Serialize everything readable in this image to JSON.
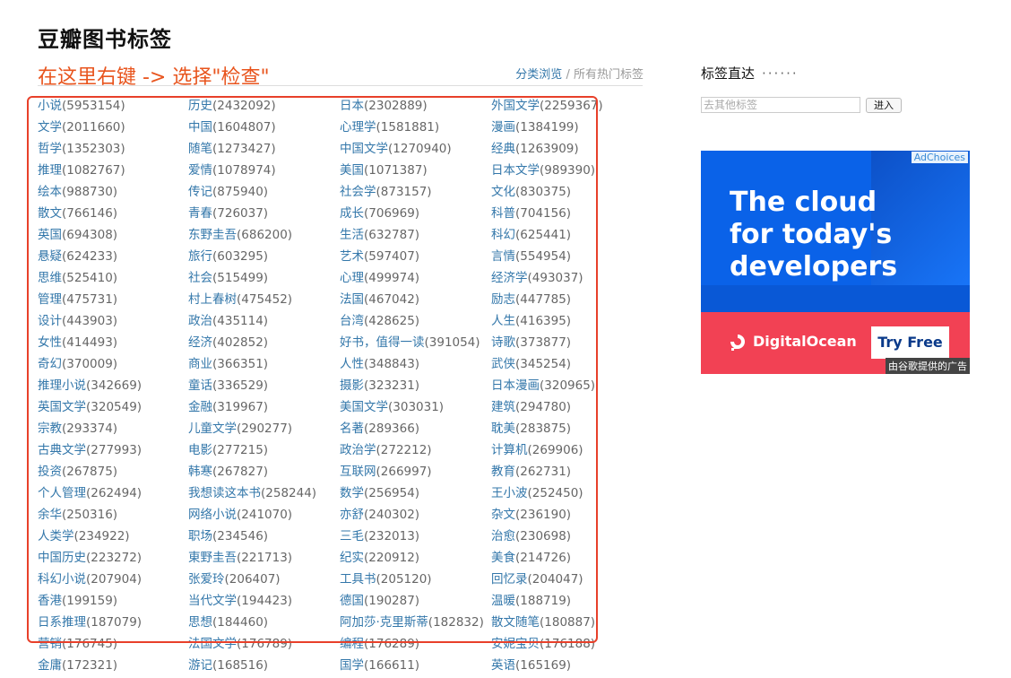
{
  "page": {
    "title": "豆瓣图书标签",
    "annotation": "在这里右键 -> 选择\"检查\"",
    "browse_link": "分类浏览",
    "separator": "/",
    "hot_tags": "所有热门标签"
  },
  "tags": [
    [
      {
        "name": "小说",
        "count": "(5953154)"
      },
      {
        "name": "历史",
        "count": "(2432092)"
      },
      {
        "name": "日本",
        "count": "(2302889)"
      },
      {
        "name": "外国文学",
        "count": "(2259367)"
      }
    ],
    [
      {
        "name": "文学",
        "count": "(2011660)"
      },
      {
        "name": "中国",
        "count": "(1604807)"
      },
      {
        "name": "心理学",
        "count": "(1581881)"
      },
      {
        "name": "漫画",
        "count": "(1384199)"
      }
    ],
    [
      {
        "name": "哲学",
        "count": "(1352303)"
      },
      {
        "name": "随笔",
        "count": "(1273427)"
      },
      {
        "name": "中国文学",
        "count": "(1270940)"
      },
      {
        "name": "经典",
        "count": "(1263909)"
      }
    ],
    [
      {
        "name": "推理",
        "count": "(1082767)"
      },
      {
        "name": "爱情",
        "count": "(1078974)"
      },
      {
        "name": "美国",
        "count": "(1071387)"
      },
      {
        "name": "日本文学",
        "count": "(989390)"
      }
    ],
    [
      {
        "name": "绘本",
        "count": "(988730)"
      },
      {
        "name": "传记",
        "count": "(875940)"
      },
      {
        "name": "社会学",
        "count": "(873157)"
      },
      {
        "name": "文化",
        "count": "(830375)"
      }
    ],
    [
      {
        "name": "散文",
        "count": "(766146)"
      },
      {
        "name": "青春",
        "count": "(726037)"
      },
      {
        "name": "成长",
        "count": "(706969)"
      },
      {
        "name": "科普",
        "count": "(704156)"
      }
    ],
    [
      {
        "name": "英国",
        "count": "(694308)"
      },
      {
        "name": "东野圭吾",
        "count": "(686200)"
      },
      {
        "name": "生活",
        "count": "(632787)"
      },
      {
        "name": "科幻",
        "count": "(625441)"
      }
    ],
    [
      {
        "name": "悬疑",
        "count": "(624233)"
      },
      {
        "name": "旅行",
        "count": "(603295)"
      },
      {
        "name": "艺术",
        "count": "(597407)"
      },
      {
        "name": "言情",
        "count": "(554954)"
      }
    ],
    [
      {
        "name": "思维",
        "count": "(525410)"
      },
      {
        "name": "社会",
        "count": "(515499)"
      },
      {
        "name": "心理",
        "count": "(499974)"
      },
      {
        "name": "经济学",
        "count": "(493037)"
      }
    ],
    [
      {
        "name": "管理",
        "count": "(475731)"
      },
      {
        "name": "村上春树",
        "count": "(475452)"
      },
      {
        "name": "法国",
        "count": "(467042)"
      },
      {
        "name": "励志",
        "count": "(447785)"
      }
    ],
    [
      {
        "name": "设计",
        "count": "(443903)"
      },
      {
        "name": "政治",
        "count": "(435114)"
      },
      {
        "name": "台湾",
        "count": "(428625)"
      },
      {
        "name": "人生",
        "count": "(416395)"
      }
    ],
    [
      {
        "name": "女性",
        "count": "(414493)"
      },
      {
        "name": "经济",
        "count": "(402852)"
      },
      {
        "name": "好书，值得一读",
        "count": "(391054)"
      },
      {
        "name": "诗歌",
        "count": "(373877)"
      }
    ],
    [
      {
        "name": "奇幻",
        "count": "(370009)"
      },
      {
        "name": "商业",
        "count": "(366351)"
      },
      {
        "name": "人性",
        "count": "(348843)"
      },
      {
        "name": "武侠",
        "count": "(345254)"
      }
    ],
    [
      {
        "name": "推理小说",
        "count": "(342669)"
      },
      {
        "name": "童话",
        "count": "(336529)"
      },
      {
        "name": "摄影",
        "count": "(323231)"
      },
      {
        "name": "日本漫画",
        "count": "(320965)"
      }
    ],
    [
      {
        "name": "英国文学",
        "count": "(320549)"
      },
      {
        "name": "金融",
        "count": "(319967)"
      },
      {
        "name": "美国文学",
        "count": "(303031)"
      },
      {
        "name": "建筑",
        "count": "(294780)"
      }
    ],
    [
      {
        "name": "宗教",
        "count": "(293374)"
      },
      {
        "name": "儿童文学",
        "count": "(290277)"
      },
      {
        "name": "名著",
        "count": "(289366)"
      },
      {
        "name": "耽美",
        "count": "(283875)"
      }
    ],
    [
      {
        "name": "古典文学",
        "count": "(277993)"
      },
      {
        "name": "电影",
        "count": "(277215)"
      },
      {
        "name": "政治学",
        "count": "(272212)"
      },
      {
        "name": "计算机",
        "count": "(269906)"
      }
    ],
    [
      {
        "name": "投资",
        "count": "(267875)"
      },
      {
        "name": "韩寒",
        "count": "(267827)"
      },
      {
        "name": "互联网",
        "count": "(266997)"
      },
      {
        "name": "教育",
        "count": "(262731)"
      }
    ],
    [
      {
        "name": "个人管理",
        "count": "(262494)"
      },
      {
        "name": "我想读这本书",
        "count": "(258244)"
      },
      {
        "name": "数学",
        "count": "(256954)"
      },
      {
        "name": "王小波",
        "count": "(252450)"
      }
    ],
    [
      {
        "name": "余华",
        "count": "(250316)"
      },
      {
        "name": "网络小说",
        "count": "(241070)"
      },
      {
        "name": "亦舒",
        "count": "(240302)"
      },
      {
        "name": "杂文",
        "count": "(236190)"
      }
    ],
    [
      {
        "name": "人类学",
        "count": "(234922)"
      },
      {
        "name": "职场",
        "count": "(234546)"
      },
      {
        "name": "三毛",
        "count": "(232013)"
      },
      {
        "name": "治愈",
        "count": "(230698)"
      }
    ],
    [
      {
        "name": "中国历史",
        "count": "(223272)"
      },
      {
        "name": "東野圭吾",
        "count": "(221713)"
      },
      {
        "name": "纪实",
        "count": "(220912)"
      },
      {
        "name": "美食",
        "count": "(214726)"
      }
    ],
    [
      {
        "name": "科幻小说",
        "count": "(207904)"
      },
      {
        "name": "张爱玲",
        "count": "(206407)"
      },
      {
        "name": "工具书",
        "count": "(205120)"
      },
      {
        "name": "回忆录",
        "count": "(204047)"
      }
    ],
    [
      {
        "name": "香港",
        "count": "(199159)"
      },
      {
        "name": "当代文学",
        "count": "(194423)"
      },
      {
        "name": "德国",
        "count": "(190287)"
      },
      {
        "name": "温暖",
        "count": "(188719)"
      }
    ],
    [
      {
        "name": "日系推理",
        "count": "(187079)"
      },
      {
        "name": "思想",
        "count": "(184460)"
      },
      {
        "name": "阿加莎·克里斯蒂",
        "count": "(182832)"
      },
      {
        "name": "散文随笔",
        "count": "(180887)"
      }
    ],
    [
      {
        "name": "营销",
        "count": "(176745)"
      },
      {
        "name": "法国文学",
        "count": "(176789)"
      },
      {
        "name": "编程",
        "count": "(176289)"
      },
      {
        "name": "安妮宝贝",
        "count": "(176188)"
      }
    ],
    [
      {
        "name": "金庸",
        "count": "(172321)"
      },
      {
        "name": "游记",
        "count": "(168516)"
      },
      {
        "name": "国学",
        "count": "(166611)"
      },
      {
        "name": "英语",
        "count": "(165169)"
      }
    ]
  ],
  "sidebar": {
    "title": "标签直达",
    "dots": "······",
    "search_placeholder": "去其他标签",
    "go_button": "进入"
  },
  "ad": {
    "adchoices": "AdChoices",
    "headline_1": "The cloud",
    "headline_2": "for today's",
    "headline_3": "developers",
    "brand": "DigitalOcean",
    "cta": "Try Free",
    "note": "由谷歌提供的广告"
  },
  "colors": {
    "link": "#3377aa",
    "annotation": "#e8541d",
    "highlight_box": "#e8402a",
    "ad_blue": "#0a62e8",
    "ad_red": "#f24154"
  }
}
